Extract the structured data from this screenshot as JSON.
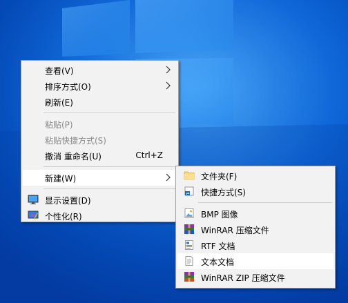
{
  "context_menu": {
    "items": [
      {
        "label": "查看(V)"
      },
      {
        "label": "排序方式(O)"
      },
      {
        "label": "刷新(E)"
      },
      {
        "label": "粘贴(P)"
      },
      {
        "label": "粘贴快捷方式(S)"
      },
      {
        "label": "撤消 重命名(U)",
        "shortcut": "Ctrl+Z"
      },
      {
        "label": "新建(W)"
      },
      {
        "label": "显示设置(D)",
        "icon": "display-settings-icon"
      },
      {
        "label": "个性化(R)",
        "icon": "personalize-icon"
      }
    ]
  },
  "submenu_new": {
    "items": [
      {
        "label": "文件夹(F)",
        "icon": "folder-icon"
      },
      {
        "label": "快捷方式(S)",
        "icon": "shortcut-icon"
      },
      {
        "label": "BMP 图像",
        "icon": "bmp-image-icon"
      },
      {
        "label": "WinRAR 压缩文件",
        "icon": "winrar-icon"
      },
      {
        "label": "RTF 文档",
        "icon": "rtf-document-icon"
      },
      {
        "label": "文本文档",
        "icon": "text-document-icon"
      },
      {
        "label": "WinRAR ZIP 压缩文件",
        "icon": "winrar-zip-icon"
      }
    ]
  }
}
